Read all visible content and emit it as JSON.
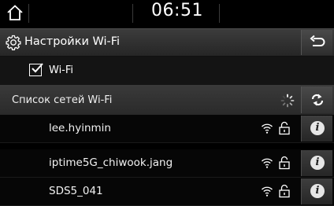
{
  "status_bar": {
    "home_icon": "home-icon",
    "time": "06:51"
  },
  "header": {
    "icon": "gear-icon",
    "title": "Настройки Wi-Fi",
    "back_icon": "back-arrow-icon"
  },
  "wifi_toggle": {
    "label": "Wi-Fi",
    "checked": true
  },
  "network_list": {
    "title": "Список сетей Wi-Fi",
    "loading_icon": "spinner-icon",
    "refresh_icon": "refresh-icon",
    "networks": [
      {
        "ssid": "lee.hyinmin",
        "secured": true,
        "info_icon": "info-icon"
      },
      {
        "ssid": "iptime5G_chiwook.jang",
        "secured": true,
        "info_icon": "info-icon"
      },
      {
        "ssid": "SDS5_041",
        "secured": true,
        "info_icon": "info-icon"
      }
    ]
  },
  "colors": {
    "background": "#000000",
    "header_gradient": "#3c3c3c",
    "text": "#ffffff"
  }
}
